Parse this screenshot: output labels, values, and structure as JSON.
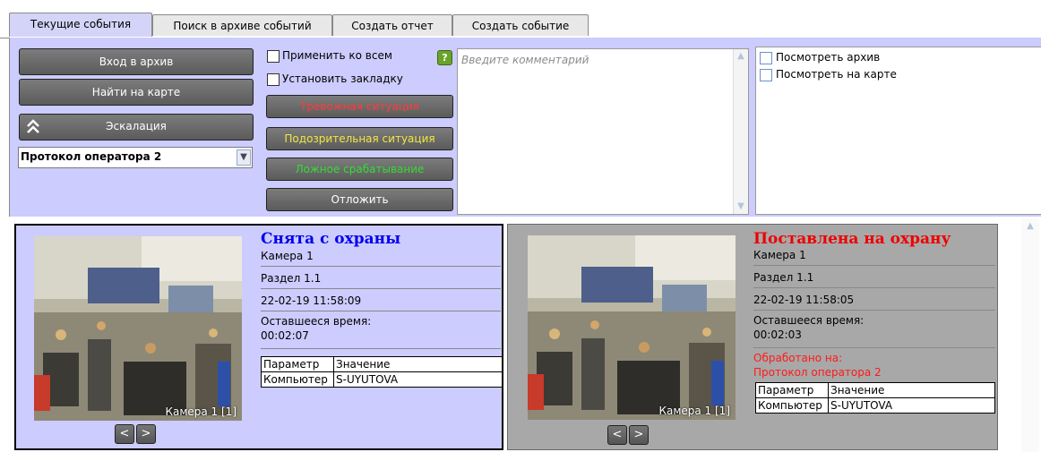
{
  "tabs": [
    {
      "label": "Текущие события",
      "active": true
    },
    {
      "label": "Поиск в архиве событий",
      "active": false
    },
    {
      "label": "Создать отчет",
      "active": false
    },
    {
      "label": "Создать событие",
      "active": false
    }
  ],
  "left_buttons": {
    "archive": "Вход в архив",
    "map": "Найти на карте",
    "escalation": "Эскалация"
  },
  "protocol_select": {
    "value": "Протокол оператора 2"
  },
  "checkboxes": {
    "apply_all": "Применить ко всем",
    "bookmark": "Установить закладку"
  },
  "classify_buttons": {
    "alarm": {
      "label": "Тревожная ситуация",
      "color": "#ff3b3b"
    },
    "suspicious": {
      "label": "Подозрительная ситуация",
      "color": "#f2e640"
    },
    "false": {
      "label": "Ложное срабатывание",
      "color": "#33dd33"
    },
    "postpone": {
      "label": "Отложить",
      "color": "#ffffff"
    }
  },
  "help_badge": "?",
  "comment": {
    "placeholder": "Введите комментарий"
  },
  "actions": [
    {
      "label": "Посмотреть архив"
    },
    {
      "label": "Посмотреть на карте"
    }
  ],
  "events": [
    {
      "title": "Снята с охраны",
      "title_color": "#0000ee",
      "camera": "Камера 1",
      "partition": "Раздел 1.1",
      "datetime": "22-02-19 11:58:09",
      "remaining_label": "Оставшееся время:",
      "remaining": "00:02:07",
      "processed_label": "",
      "processed_by": "",
      "table": {
        "headers": [
          "Параметр",
          "Значение"
        ],
        "rows": [
          [
            "Компьютер",
            "S-UYUTOVA"
          ]
        ]
      },
      "thumb_label": "Камера 1 [1]",
      "prev": "<",
      "next": ">"
    },
    {
      "title": "Поставлена на охрану",
      "title_color": "#ee0000",
      "camera": "Камера 1",
      "partition": "Раздел 1.1",
      "datetime": "22-02-19 11:58:05",
      "remaining_label": "Оставшееся время:",
      "remaining": "00:02:03",
      "processed_label": "Обработано на:",
      "processed_by": "Протокол оператора 2",
      "table": {
        "headers": [
          "Параметр",
          "Значение"
        ],
        "rows": [
          [
            "Компьютер",
            "S-UYUTOVA"
          ]
        ]
      },
      "thumb_label": "Камера 1 [1]",
      "prev": "<",
      "next": ">"
    }
  ]
}
